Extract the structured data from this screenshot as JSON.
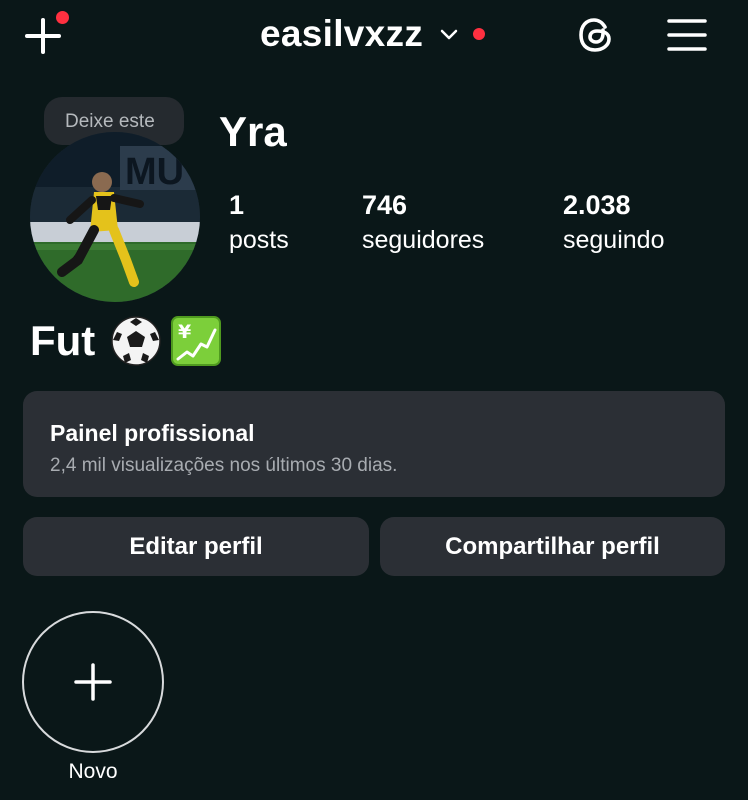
{
  "topbar": {
    "username": "easilvxzz",
    "create_icon": "plus-icon",
    "threads_icon": "threads-icon",
    "menu_icon": "hamburger-menu-icon",
    "notification_color": "#ff3040"
  },
  "profile": {
    "note_text": "Deixe este",
    "display_name": "Yra",
    "stats": {
      "posts": {
        "value": "1",
        "label": "posts"
      },
      "followers": {
        "value": "746",
        "label": "seguidores"
      },
      "following": {
        "value": "2.038",
        "label": "seguindo"
      }
    },
    "bio": "Fut",
    "bio_emojis": [
      "soccer-ball-icon",
      "yen-chart-icon"
    ]
  },
  "dashboard": {
    "title": "Painel profissional",
    "subtitle": "2,4 mil visualizações nos últimos 30 dias."
  },
  "actions": {
    "edit_label": "Editar perfil",
    "share_label": "Compartilhar perfil"
  },
  "highlights": {
    "new_label": "Novo"
  },
  "colors": {
    "background": "#0a1718",
    "card": "#2b2f35",
    "muted_text": "#a8acb1"
  }
}
